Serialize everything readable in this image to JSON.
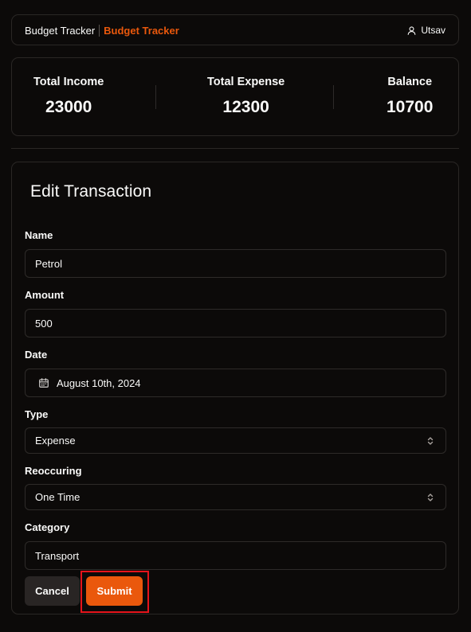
{
  "header": {
    "title": "Budget Tracker",
    "brand": "Budget Tracker",
    "user_name": "Utsav",
    "user_icon": "user-icon"
  },
  "stats": {
    "income_label": "Total Income",
    "income_value": "23000",
    "expense_label": "Total Expense",
    "expense_value": "12300",
    "balance_label": "Balance",
    "balance_value": "10700"
  },
  "form": {
    "title": "Edit Transaction",
    "name_label": "Name",
    "name_value": "Petrol",
    "amount_label": "Amount",
    "amount_value": "500",
    "date_label": "Date",
    "date_value": "August 10th, 2024",
    "date_icon": "calendar-icon",
    "type_label": "Type",
    "type_value": "Expense",
    "reoccuring_label": "Reoccuring",
    "reoccuring_value": "One Time",
    "category_label": "Category",
    "category_value": "Transport",
    "cancel_label": "Cancel",
    "submit_label": "Submit"
  },
  "colors": {
    "accent": "#ea580c",
    "background": "#0c0a09",
    "border": "#2a2725",
    "highlight": "#e5141b"
  }
}
